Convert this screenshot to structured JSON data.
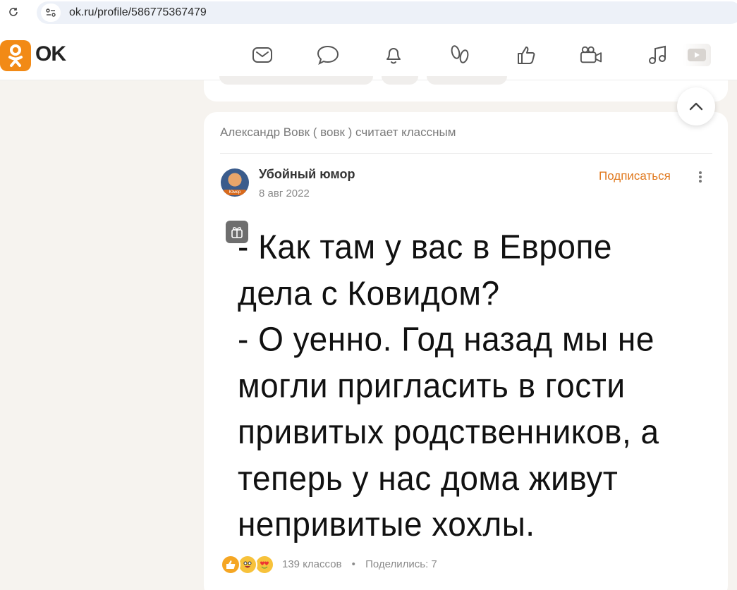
{
  "browser": {
    "url": "ok.ru/profile/586775367479",
    "icons": [
      "reload-icon",
      "site-info-icon"
    ]
  },
  "header": {
    "logo_text": "OK",
    "brand_color": "#f28a16",
    "nav_icons": [
      "messages-icon",
      "discussions-icon",
      "notifications-icon",
      "guests-icon",
      "reactions-icon",
      "video-icon",
      "music-icon",
      "video-showcase-icon"
    ]
  },
  "feed": {
    "activity": "Александр Вовк ( вовк ) считает классным",
    "post": {
      "group_name": "Убойный юмор",
      "avatar_caption": "Юмор",
      "date": "8 авг 2022",
      "subscribe_label": "Подписаться",
      "image_text_lines": [
        "- Как там у вас в Европе",
        "дела с Ковидом?",
        "- О  уенно. Год назад мы не",
        "могли пригласить в гости",
        "привитых родственников, а",
        "теперь у нас дома живут",
        "непривитые хохлы."
      ],
      "reactions": [
        "like",
        "laugh",
        "love"
      ],
      "likes": "139 классов",
      "separator": "•",
      "shares": "Поделились: 7"
    }
  }
}
